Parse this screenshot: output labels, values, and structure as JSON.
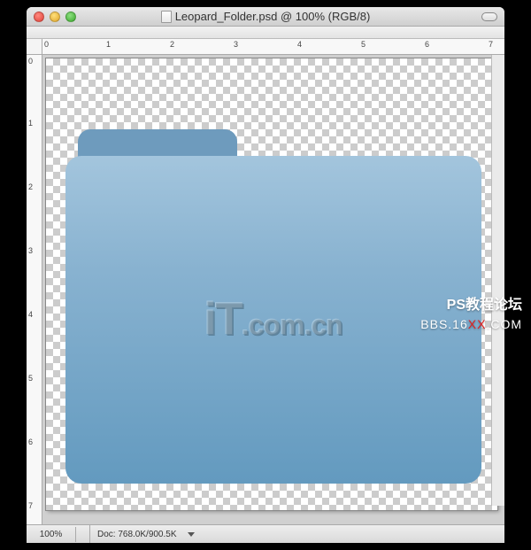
{
  "titlebar": {
    "file_title": "Leopard_Folder.psd @ 100% (RGB/8)"
  },
  "rulers": {
    "h": [
      "0",
      "1",
      "2",
      "3",
      "4",
      "5",
      "6",
      "7"
    ],
    "v": [
      "0",
      "1",
      "2",
      "3",
      "4",
      "5",
      "6",
      "7"
    ]
  },
  "statusbar": {
    "zoom": "100%",
    "doc_info": "Doc: 768.0K/900.5K"
  },
  "watermark": {
    "line1": "PS教程论坛",
    "line2_a": "BBS.16",
    "line2_xx": "XX",
    "line2_b": ".COM"
  },
  "canvas": {
    "logo_big": "iT",
    "logo_small": ".com.cn"
  }
}
